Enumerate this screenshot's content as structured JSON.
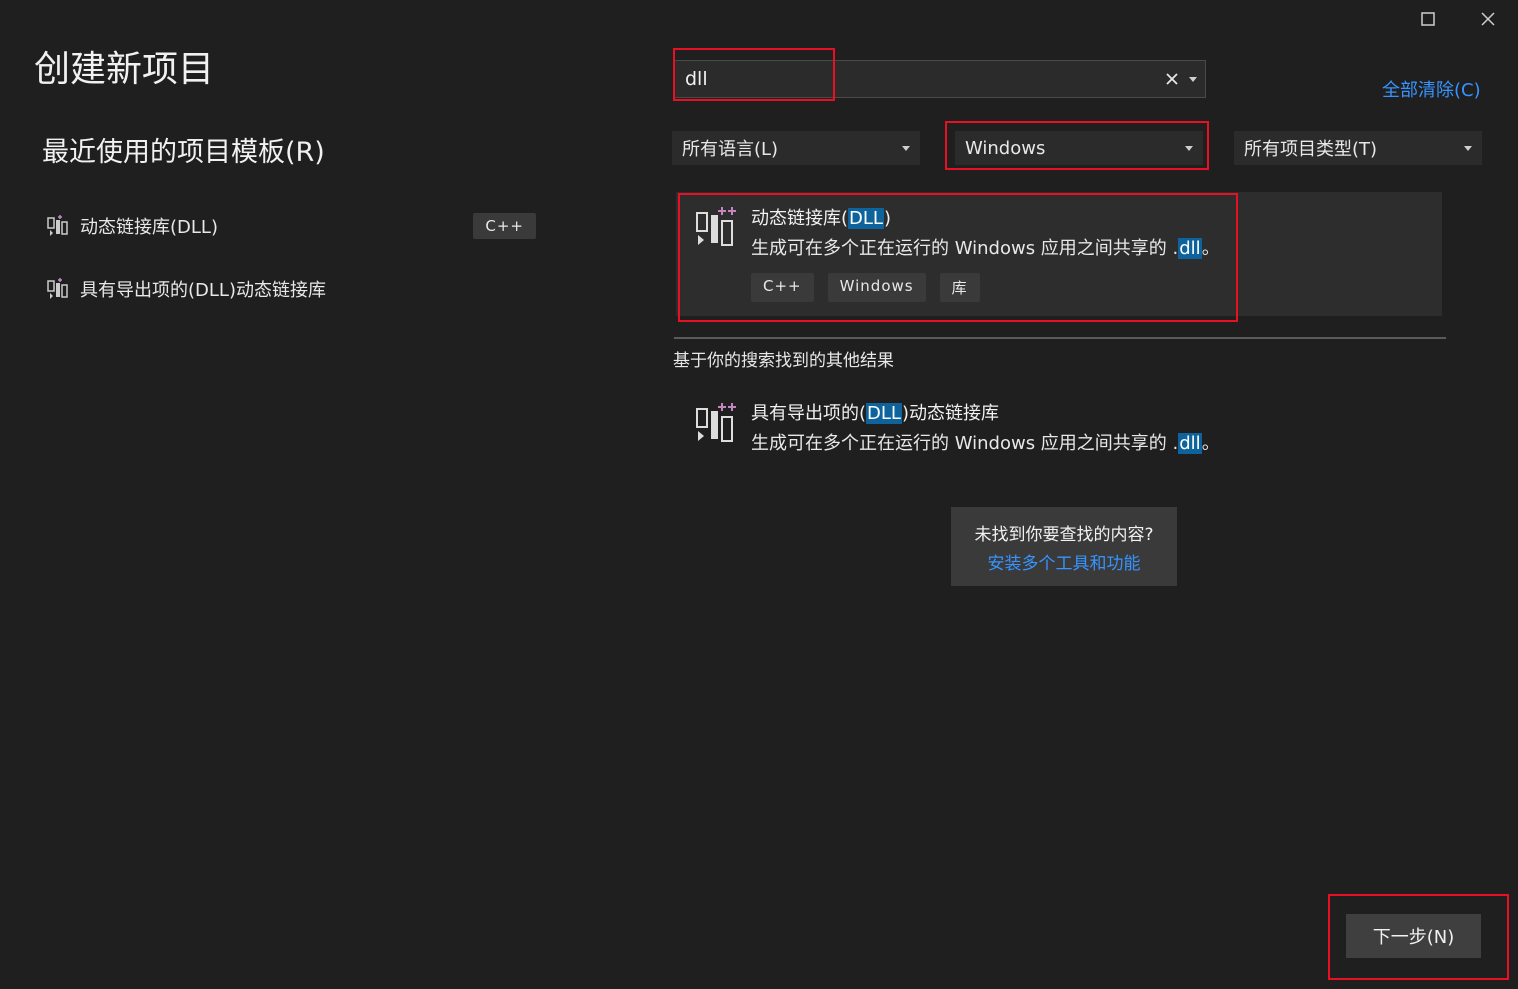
{
  "window": {
    "title": "创建新项目"
  },
  "recent": {
    "title": "最近使用的项目模板(R)",
    "items": [
      {
        "label": "动态链接库(DLL)",
        "tag": "C++"
      },
      {
        "label": "具有导出项的(DLL)动态链接库",
        "tag": ""
      }
    ]
  },
  "search": {
    "value": "dll",
    "clear_all": "全部清除(C)"
  },
  "filters": {
    "language": "所有语言(L)",
    "platform": "Windows",
    "project_type": "所有项目类型(T)"
  },
  "results": {
    "primary": {
      "title_before": "动态链接库(",
      "title_hl": "DLL",
      "title_after": ")",
      "desc_before": "生成可在多个正在运行的 Windows 应用之间共享的 .",
      "desc_hl": "dll",
      "desc_after": "。",
      "tags": [
        "C++",
        "Windows",
        "库"
      ]
    },
    "other_label": "基于你的搜索找到的其他结果",
    "other": {
      "title_before": "具有导出项的(",
      "title_hl": "DLL",
      "title_after": ")动态链接库",
      "desc_before": "生成可在多个正在运行的 Windows 应用之间共享的 .",
      "desc_hl": "dll",
      "desc_after": "。"
    }
  },
  "not_found": {
    "text": "未找到你要查找的内容?",
    "link": "安装多个工具和功能"
  },
  "footer": {
    "next_label": "下一步(N)"
  },
  "colors": {
    "accent": "#3794ff",
    "highlight": "#0e639c",
    "annotation": "#e81123"
  }
}
